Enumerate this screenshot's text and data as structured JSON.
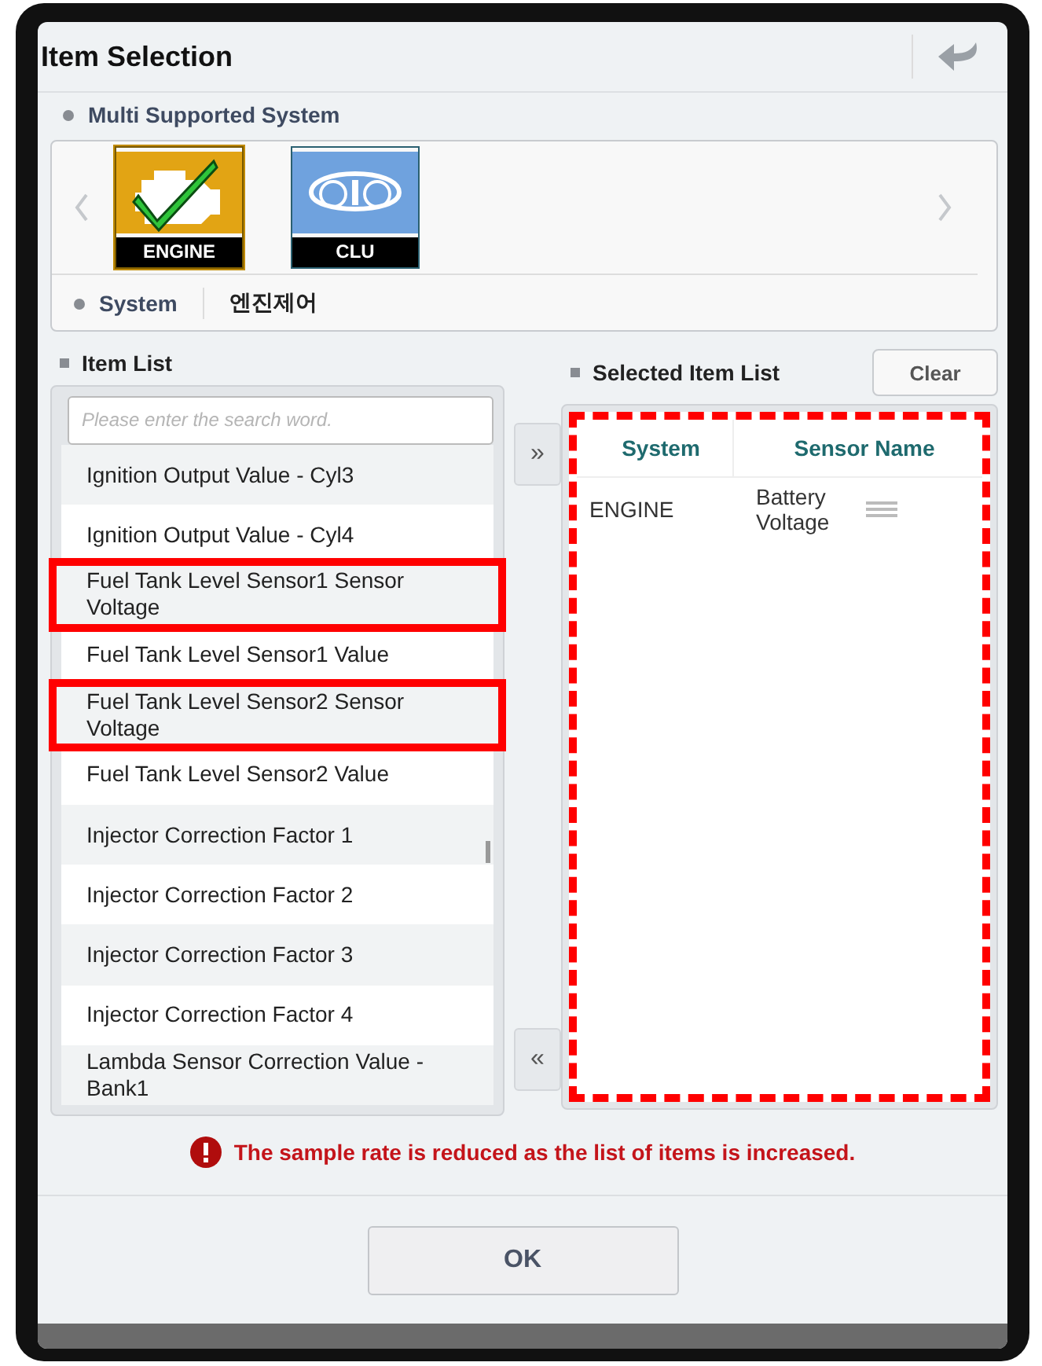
{
  "window": {
    "title": "Item Selection"
  },
  "multi_system": {
    "label": "Multi Supported System",
    "systems": [
      {
        "kind": "engine",
        "label": "ENGINE",
        "checked": true
      },
      {
        "kind": "cluster",
        "label": "CLU",
        "checked": false
      }
    ],
    "system_label": "System",
    "system_value": "엔진제어"
  },
  "item_list": {
    "label": "Item List",
    "search": {
      "placeholder": "Please enter the search word."
    },
    "items": [
      {
        "label": "Ignition Output Value - Cyl3",
        "highlighted": false
      },
      {
        "label": "Ignition Output Value - Cyl4",
        "highlighted": false
      },
      {
        "label": "Fuel Tank Level Sensor1 Sensor Voltage",
        "highlighted": true
      },
      {
        "label": "Fuel Tank Level Sensor1 Value",
        "highlighted": false
      },
      {
        "label": "Fuel Tank Level Sensor2 Sensor Voltage",
        "highlighted": true
      },
      {
        "label": "Fuel Tank Level Sensor2 Value",
        "highlighted": false
      },
      {
        "label": "Injector Correction Factor 1",
        "highlighted": false
      },
      {
        "label": "Injector Correction Factor 2",
        "highlighted": false
      },
      {
        "label": "Injector Correction Factor 3",
        "highlighted": false
      },
      {
        "label": "Injector Correction Factor 4",
        "highlighted": false
      },
      {
        "label": "Lambda Sensor Correction Value - Bank1",
        "highlighted": false
      }
    ]
  },
  "add_button": "»",
  "remove_button": "«",
  "selected_list": {
    "label": "Selected Item List",
    "clear_button": "Clear",
    "highlighted": true,
    "columns": [
      "System",
      "Sensor Name"
    ],
    "rows": [
      {
        "system": "ENGINE",
        "sensor_name": "Battery Voltage"
      }
    ]
  },
  "warning": "The sample rate is reduced as the list of items is increased.",
  "ok_button": "OK"
}
